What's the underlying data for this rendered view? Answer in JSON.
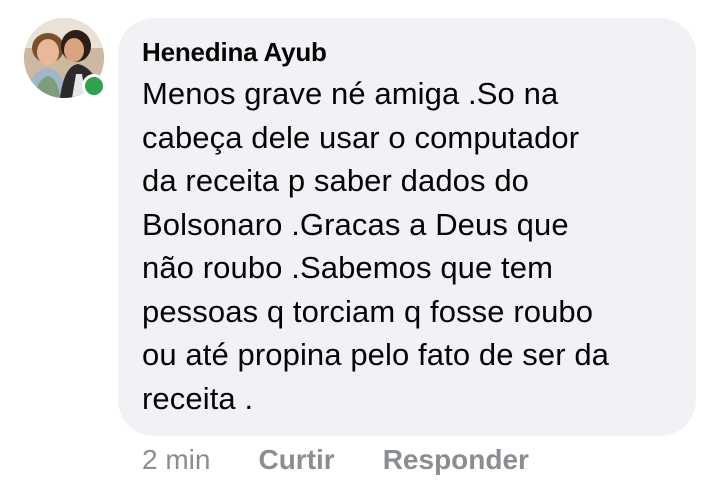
{
  "comment": {
    "author": "Henedina Ayub",
    "text": "Menos grave né amiga .So na\ncabeça dele usar o computador\nda receita p saber dados do\nBolsonaro .Gracas a Deus que\nnão roubo .Sabemos que tem\npessoas q torciam q fosse roubo\nou até propina pelo fato de ser da\nreceita .",
    "time": "2 min",
    "like_label": "Curtir",
    "reply_label": "Responder",
    "online": true
  },
  "colors": {
    "bubble": "#f0f2f5",
    "text": "#050505",
    "meta": "#8a8d91",
    "online": "#31a24c"
  },
  "icons": {
    "avatar": "profile-photo",
    "status": "online-status-dot"
  }
}
